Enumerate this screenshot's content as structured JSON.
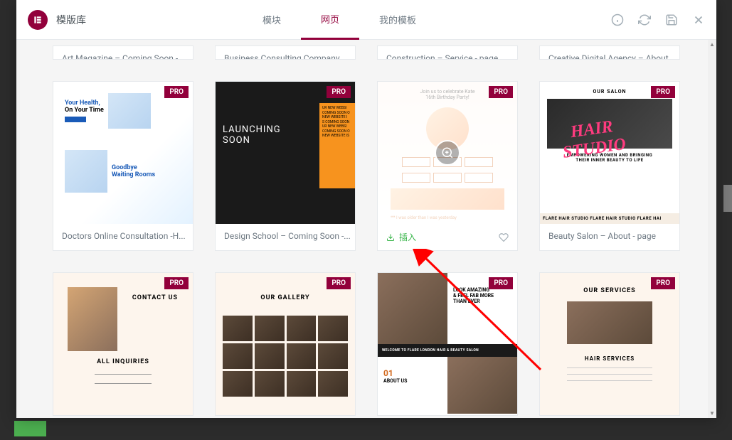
{
  "header": {
    "title": "模版库",
    "tabs": [
      {
        "label": "模块",
        "active": false
      },
      {
        "label": "网页",
        "active": true
      },
      {
        "label": "我的模板",
        "active": false
      }
    ]
  },
  "badges": {
    "pro": "PRO"
  },
  "hover": {
    "insert_label": "插入"
  },
  "row_partial": [
    {
      "title": "Art Magazine – Coming Soon - ..."
    },
    {
      "title": "Business Consulting Company ..."
    },
    {
      "title": "Construction – Service - page"
    },
    {
      "title": "Creative Digital Agency – About..."
    }
  ],
  "row2": [
    {
      "title": "Doctors Online Consultation -H...",
      "pro": true
    },
    {
      "title": "Design School – Coming Soon -...",
      "pro": true
    },
    {
      "title": "",
      "pro": true,
      "hovered": true
    },
    {
      "title": "Beauty Salon – About - page",
      "pro": true
    }
  ],
  "row3": [
    {
      "title": "",
      "pro": true
    },
    {
      "title": "",
      "pro": true
    },
    {
      "title": "",
      "pro": true
    },
    {
      "title": "",
      "pro": true
    }
  ],
  "thumbs": {
    "doctors": {
      "heading": "Your Health,",
      "sub": "On Your Time",
      "waiting": "Goodbye\nWaiting Rooms"
    },
    "design": {
      "heading": "LAUNCHING\nSOON",
      "strip": "UR NEW WEBSI\nCOMING SOON O\nNEW WEBSITE I\nS COMING SOON\nUR NEW WEBSI\nCOMING SOON O\nNEW WEBSITE IS"
    },
    "birthday": {
      "heading": "Join us to celebrate Kate\n16th Birthday Party!",
      "quote": "I was older than I was yesterday"
    },
    "salon": {
      "top": "OUR SALON",
      "neon": "HAIR\nSTUDIO",
      "tagline": "EMPOWERING WOMEN AND BRINGING\nTHEIR INNER BEAUTY TO LIFE",
      "marquee": "FLARE HAIR STUDIO FLARE HAIR STUDIO FLARE HAI"
    },
    "contact": {
      "heading": "CONTACT US",
      "sub": "ALL INQUIRIES"
    },
    "gallery": {
      "heading": "OUR GALLERY"
    },
    "about": {
      "heading": "LOOK AMAZING\n& FEEL FAB MORE\nTHAN EVER",
      "mid": "WELCOME TO FLARE LONDON HAIR & BEAUTY SALON",
      "sub": "ABOUT US",
      "num": "01"
    },
    "services": {
      "heading": "OUR SERVICES",
      "sub": "HAIR SERVICES"
    }
  }
}
